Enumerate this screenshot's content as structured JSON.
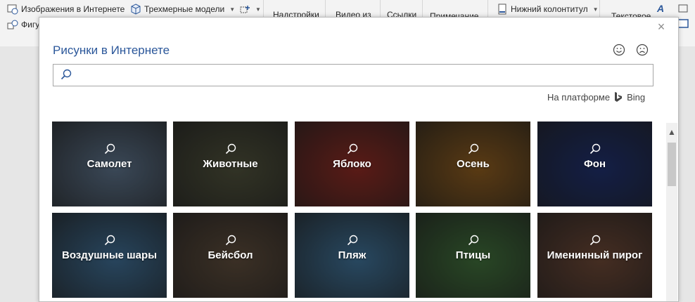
{
  "ribbon": {
    "online_pictures": "Изображения в Интернете",
    "models_3d": "Трехмерные модели",
    "shapes": "Фигу",
    "addins": "Надстройки",
    "online_video": "Видео из",
    "links": "Ссылки",
    "comment": "Примечание",
    "footer": "Нижний колонтитул",
    "textbox": "Текстовое"
  },
  "dialog": {
    "title": "Рисунки в Интернете",
    "search_placeholder": "",
    "powered_by": "На платформе",
    "bing": "Bing"
  },
  "categories": [
    {
      "label": "Самолет",
      "color": "#5a6f86"
    },
    {
      "label": "Животные",
      "color": "#4d4f3a"
    },
    {
      "label": "Яблоко",
      "color": "#8a2a22"
    },
    {
      "label": "Осень",
      "color": "#8a5a1e"
    },
    {
      "label": "Фон",
      "color": "#1f2f6b"
    },
    {
      "label": "Воздушные шары",
      "color": "#3d6a8f"
    },
    {
      "label": "Бейсбол",
      "color": "#5b4a3a"
    },
    {
      "label": "Пляж",
      "color": "#3e6f94"
    },
    {
      "label": "Птицы",
      "color": "#3f6d3a"
    },
    {
      "label": "Именинный пирог",
      "color": "#6a4635"
    }
  ]
}
